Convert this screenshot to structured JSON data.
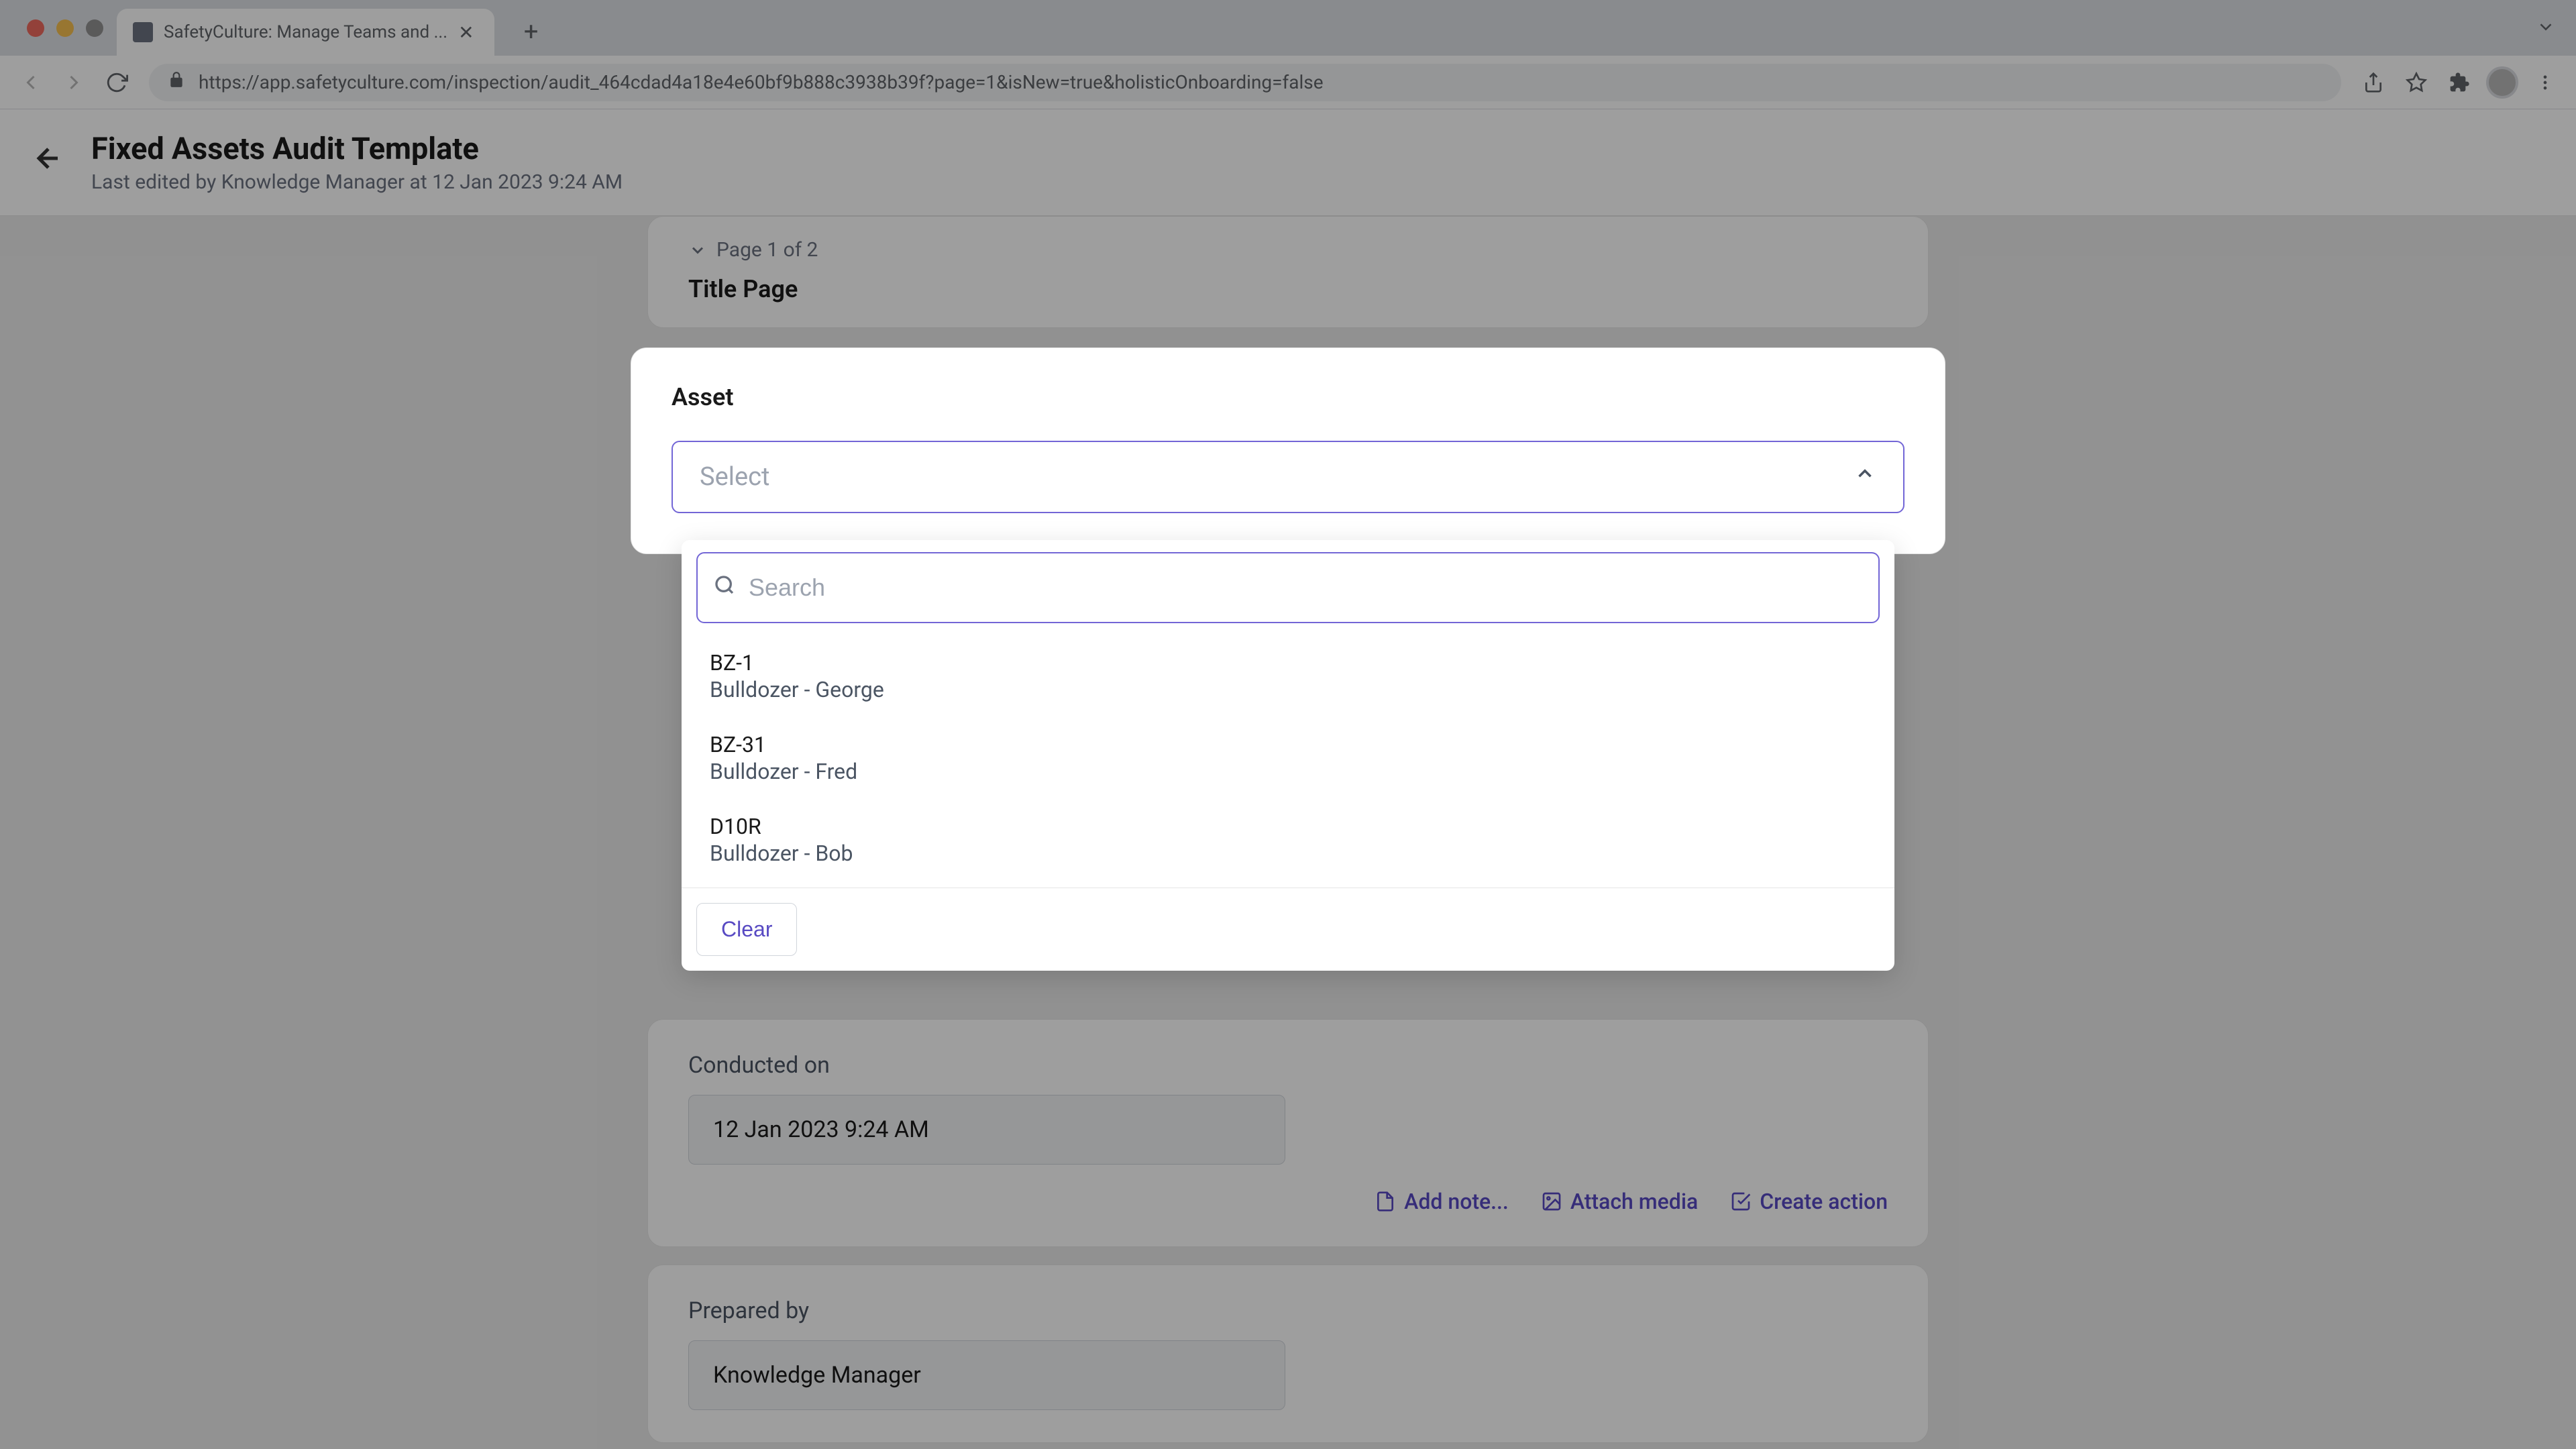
{
  "browser": {
    "tab_title": "SafetyCulture: Manage Teams and ...",
    "url": "https://app.safetyculture.com/inspection/audit_464cdad4a18e4e60bf9b888c3938b39f?page=1&isNew=true&holisticOnboarding=false"
  },
  "header": {
    "title": "Fixed Assets Audit Template",
    "subtitle": "Last edited by Knowledge Manager at 12 Jan 2023 9:24 AM"
  },
  "page_indicator": "Page 1 of 2",
  "page_title": "Title Page",
  "asset": {
    "label": "Asset",
    "placeholder": "Select",
    "search_placeholder": "Search",
    "options": [
      {
        "code": "BZ-1",
        "desc": "Bulldozer - George"
      },
      {
        "code": "BZ-31",
        "desc": "Bulldozer - Fred"
      },
      {
        "code": "D10R",
        "desc": "Bulldozer - Bob"
      }
    ],
    "clear_label": "Clear"
  },
  "conducted_on": {
    "label": "Conducted on",
    "value": "12 Jan 2023 9:24 AM"
  },
  "prepared_by": {
    "label": "Prepared by",
    "value": "Knowledge Manager"
  },
  "actions": {
    "add_note": "Add note...",
    "attach_media": "Attach media",
    "create_action": "Create action"
  }
}
